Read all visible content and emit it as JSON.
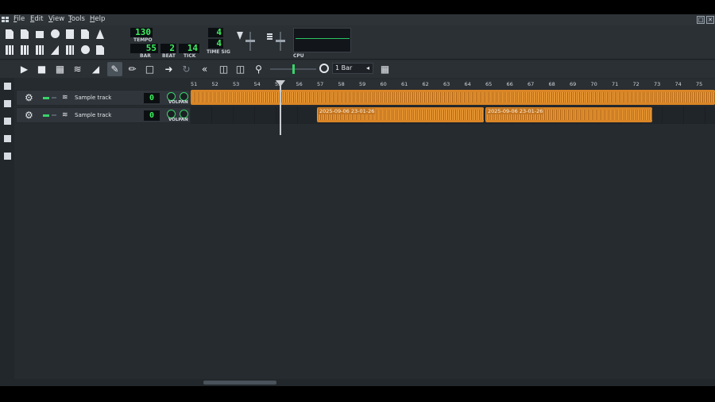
{
  "menu": {
    "items": [
      {
        "label": "File",
        "u": "F",
        "rest": "ile"
      },
      {
        "label": "Edit",
        "u": "E",
        "rest": "dit"
      },
      {
        "label": "View",
        "u": "V",
        "rest": "iew"
      },
      {
        "label": "Tools",
        "u": "T",
        "rest": "ools"
      },
      {
        "label": "Help",
        "u": "H",
        "rest": "elp"
      }
    ]
  },
  "transport": {
    "tempo": "130",
    "tempo_label": "TEMPO",
    "bar": "55",
    "bar_label": "BAR",
    "beat": "2",
    "beat_label": "BEAT",
    "tick": "14",
    "tick_label": "TICK",
    "time_sig_num": "4",
    "time_sig_den": "4",
    "time_sig_label": "TIME SIG",
    "cpu_label": "CPU"
  },
  "edit": {
    "quantize": "1 Bar"
  },
  "ruler": {
    "bars": [
      "51",
      "52",
      "53",
      "54",
      "55",
      "56",
      "57",
      "58",
      "59",
      "60",
      "61",
      "62",
      "63",
      "64",
      "65",
      "66",
      "67",
      "68",
      "69",
      "70",
      "71",
      "72",
      "73",
      "74",
      "75"
    ]
  },
  "tracks": [
    {
      "name": "Sample track",
      "volume_value": "0",
      "volpan": "VOLPAN"
    },
    {
      "name": "Sample track",
      "volume_value": "0",
      "volpan": "VOLPAN"
    }
  ],
  "clips": [
    {
      "label": "2025-09-06 23-01-26"
    },
    {
      "label": "2025-09-06 23-01-26"
    }
  ],
  "icons": {
    "toolbar": [
      "new-file-icon",
      "new-from-template-icon",
      "open-folder-icon",
      "recent-icon",
      "save-icon",
      "export-icon",
      "export-tracks-icon",
      "song-editor-icon",
      "beat-editor-icon",
      "piano-roll-icon",
      "automation-icon",
      "mixer-icon",
      "controller-icon",
      "project-notes-icon"
    ],
    "edit": [
      "play-icon",
      "stop-icon",
      "add-beat-icon",
      "add-sample-icon",
      "add-automation-icon",
      "draw-icon",
      "knife-icon",
      "select-icon",
      "record-icon",
      "loop-icon",
      "rewind-icon",
      "zoom-icon",
      "snap-icon"
    ]
  }
}
